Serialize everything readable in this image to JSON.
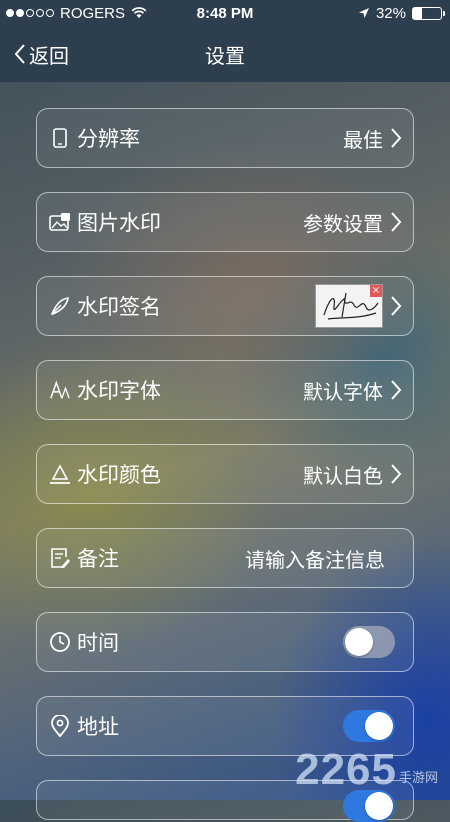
{
  "status_bar": {
    "carrier": "ROGERS",
    "time": "8:48 PM",
    "battery": "32%",
    "battery_level": 0.32,
    "signal_bars": 2
  },
  "nav": {
    "back_label": "返回",
    "title": "设置"
  },
  "rows": [
    {
      "label": "分辨率",
      "value": "最佳",
      "icon": "phone-icon"
    },
    {
      "label": "图片水印",
      "value": "参数设置",
      "icon": "image-watermark-icon"
    },
    {
      "label": "水印签名",
      "icon": "pen-icon"
    },
    {
      "label": "水印字体",
      "value": "默认字体",
      "icon": "font-icon"
    },
    {
      "label": "水印颜色",
      "value": "默认白色",
      "icon": "color-icon"
    },
    {
      "label": "备注",
      "value": "请输入备注信息",
      "icon": "note-icon"
    },
    {
      "label": "时间",
      "toggle": false,
      "icon": "clock-icon"
    },
    {
      "label": "地址",
      "toggle": true,
      "icon": "location-icon"
    }
  ],
  "watermark": {
    "number": "2265",
    "text": "手游网"
  },
  "colors": {
    "bar": "#2d3e4e",
    "toggle_on": "#2f78e0"
  }
}
